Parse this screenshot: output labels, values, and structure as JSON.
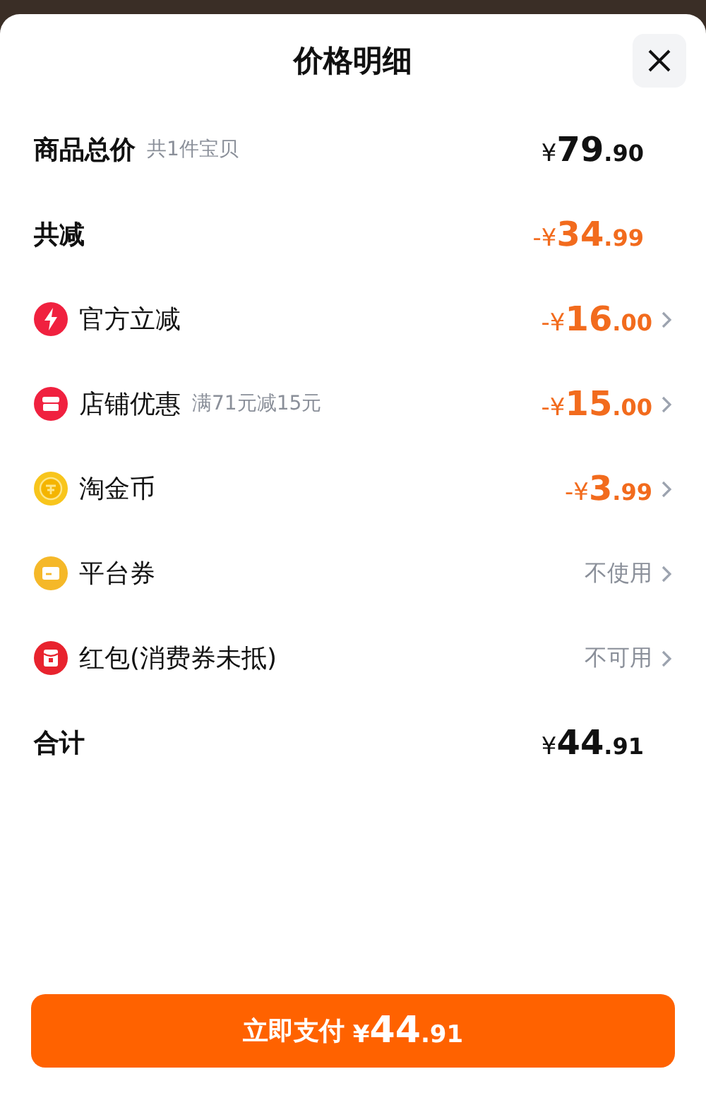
{
  "title": "价格明细",
  "rows": [
    {
      "kind": "summary",
      "label": "商品总价",
      "note": "共1件宝贝",
      "value": {
        "kind": "price",
        "sign": "¥",
        "main": "79",
        "fraction": ".90"
      }
    },
    {
      "kind": "summary",
      "label": "共减",
      "value": {
        "kind": "discount",
        "sign": "-¥",
        "main": "34",
        "fraction": ".99"
      }
    },
    {
      "kind": "lightning",
      "label": "官方立减",
      "value": {
        "kind": "discount",
        "sign": "-¥",
        "main": "16",
        "fraction": ".00"
      }
    },
    {
      "kind": "store",
      "label": "店铺优惠",
      "note": "满71元减15元",
      "value": {
        "kind": "discount",
        "sign": "-¥",
        "main": "15",
        "fraction": ".00"
      }
    },
    {
      "kind": "coin",
      "label": "淘金币",
      "value": {
        "kind": "discount",
        "sign": "-¥",
        "main": "3",
        "fraction": ".99"
      }
    },
    {
      "kind": "coupon",
      "label": "平台券",
      "value": {
        "kind": "status",
        "text": "不使用"
      }
    },
    {
      "kind": "envelope",
      "label": "红包(消费券未抵)",
      "value": {
        "kind": "status",
        "text": "不可用"
      }
    },
    {
      "kind": "summary",
      "label": "合计",
      "value": {
        "kind": "price",
        "sign": "¥",
        "main": "44",
        "fraction": ".91"
      }
    }
  ],
  "pay_button": {
    "label": "立即支付",
    "sign": "¥",
    "main": "44",
    "fraction": ".91"
  }
}
